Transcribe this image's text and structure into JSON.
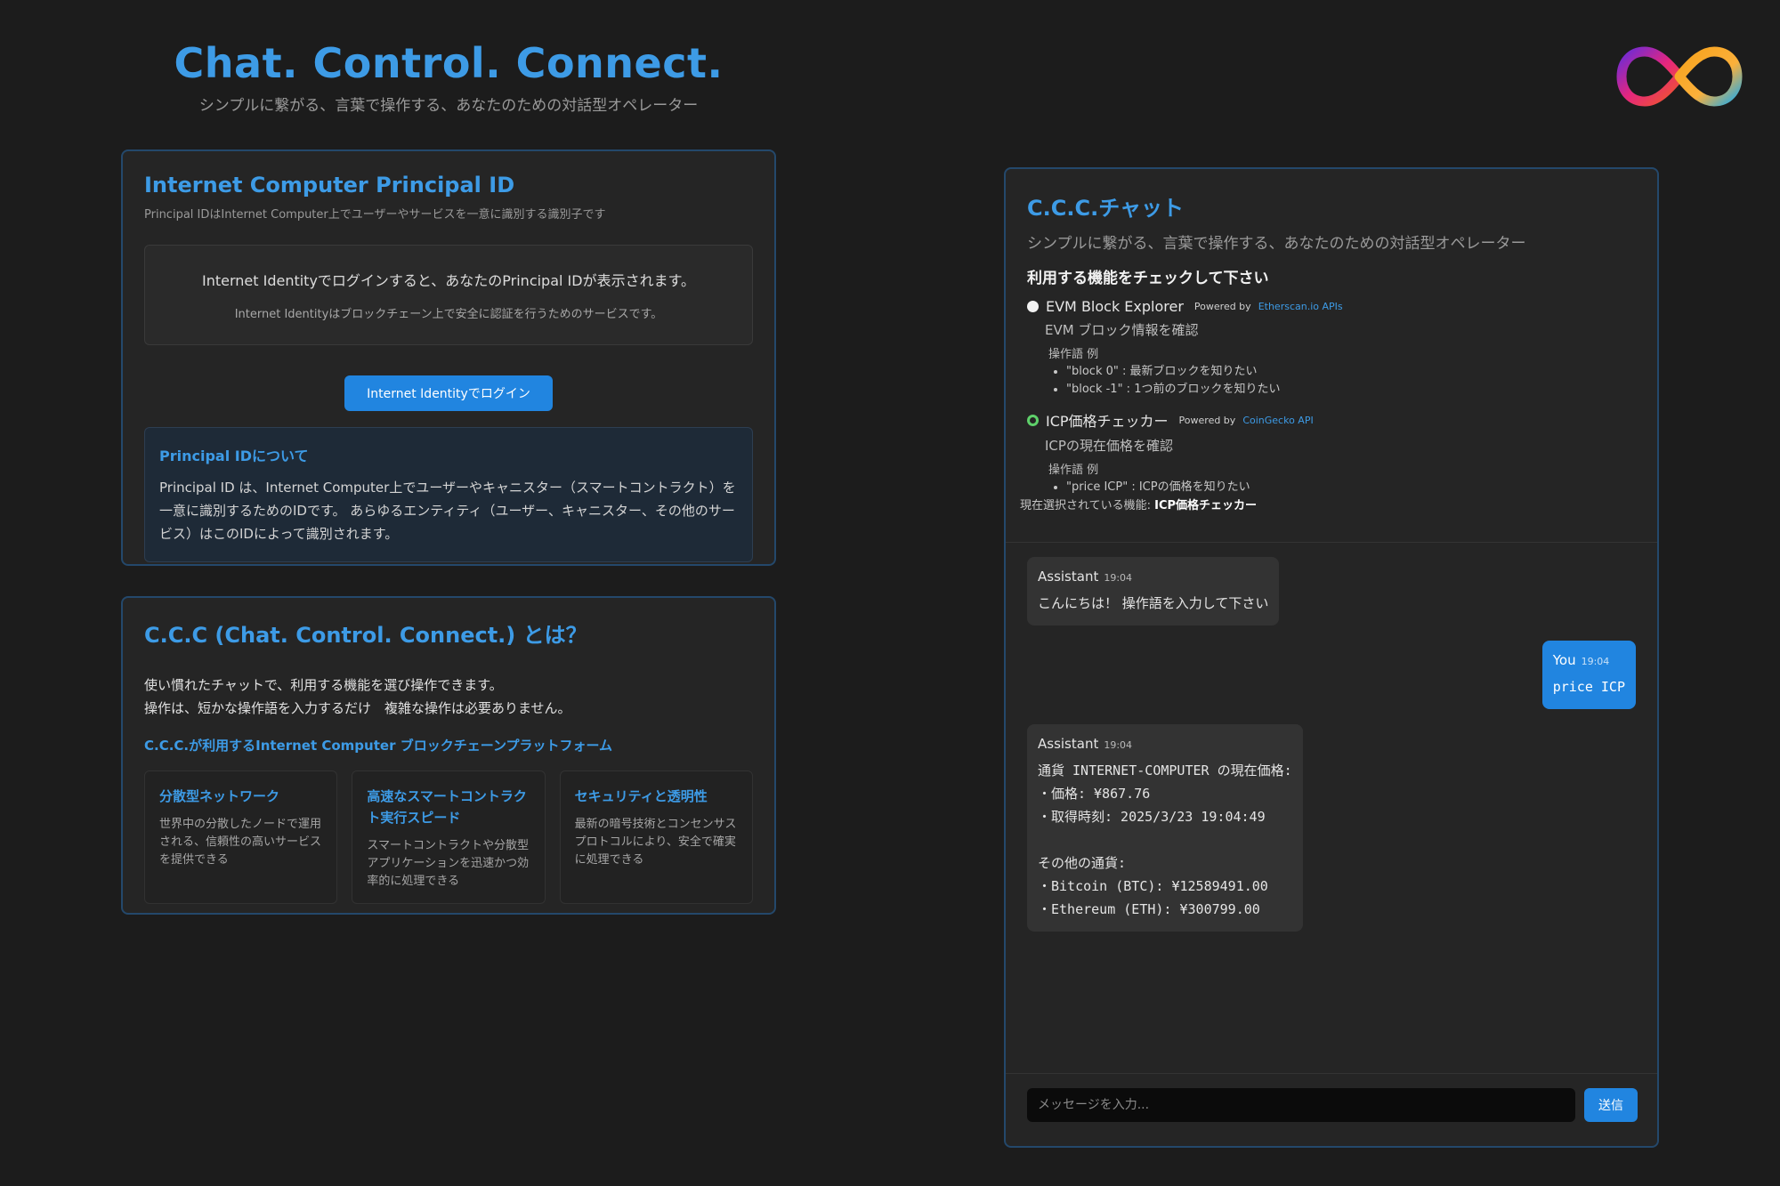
{
  "hero": {
    "title": "Chat. Control. Connect.",
    "subtitle": "シンプルに繋がる、言葉で操作する、あなたのための対話型オペレーター"
  },
  "logo": {
    "icon": "infinity-logo-icon"
  },
  "principal": {
    "title": "Internet Computer Principal ID",
    "description": "Principal IDはInternet Computer上でユーザーやサービスを一意に識別する識別子です",
    "login_box": {
      "line1": "Internet Identityでログインすると、あなたのPrincipal IDが表示されます。",
      "line2": "Internet Identityはブロックチェーン上で安全に認証を行うためのサービスです。"
    },
    "login_button": "Internet Identityでログイン",
    "about": {
      "title": "Principal IDについて",
      "body": "Principal ID は、Internet Computer上でユーザーやキャニスター（スマートコントラクト）を一意に識別するためのIDです。 あらゆるエンティティ（ユーザー、キャニスター、その他のサービス）はこのIDによって識別されます。"
    }
  },
  "ccc": {
    "title": "C.C.C (Chat. Control. Connect.) とは？",
    "line1": "使い慣れたチャットで、利用する機能を選び操作できます。",
    "line2": "操作は、短かな操作語を入力するだけ　複雑な操作は必要ありません。",
    "platform_link": "C.C.C.が利用するInternet Computer ブロックチェーンプラットフォーム",
    "features": [
      {
        "title": "分散型ネットワーク",
        "body": "世界中の分散したノードで運用される、信頼性の高いサービスを提供できる"
      },
      {
        "title": "高速なスマートコントラクト実行スピード",
        "body": "スマートコントラクトや分散型アプリケーションを迅速かつ効率的に処理できる"
      },
      {
        "title": "セキュリティと透明性",
        "body": "最新の暗号技術とコンセンサスプロトコルにより、安全で確実に処理できる"
      }
    ]
  },
  "chat": {
    "title": "C.C.C.チャット",
    "subtitle": "シンプルに繋がる、言葉で操作する、あなたのための対話型オペレーター",
    "check_label": "利用する機能をチェックして下さい",
    "options": [
      {
        "name": "EVM Block Explorer",
        "powered_by": "Powered by",
        "api": "Etherscan.io APIs",
        "desc": "EVM ブロック情報を確認",
        "examples_label": "操作語 例",
        "examples": [
          "\"block 0\" : 最新ブロックを知りたい",
          "\"block -1\" : 1つ前のブロックを知りたい"
        ],
        "selected": false
      },
      {
        "name": "ICP価格チェッカー",
        "powered_by": "Powered by",
        "api": "CoinGecko API",
        "desc": "ICPの現在価格を確認",
        "examples_label": "操作語 例",
        "examples": [
          "\"price ICP\" : ICPの価格を知りたい"
        ],
        "selected": true
      }
    ],
    "current_label": "現在選択されている機能:",
    "current_value": "ICP価格チェッカー",
    "messages": [
      {
        "sender": "Assistant",
        "time": "19:04",
        "text": "こんにちは！ 操作語を入力して下さい"
      },
      {
        "sender": "You",
        "time": "19:04",
        "text": "price ICP"
      },
      {
        "sender": "Assistant",
        "time": "19:04",
        "text": "通貨 INTERNET-COMPUTER の現在価格:\n・価格: ¥867.76\n・取得時刻: 2025/3/23 19:04:49\n\nその他の通貨:\n・Bitcoin (BTC): ¥12589491.00\n・Ethereum (ETH): ¥300799.00"
      }
    ],
    "input_placeholder": "メッセージを入力...",
    "send_label": "送信"
  },
  "colors": {
    "accent": "#3d9be6",
    "button": "#2185e0",
    "card_border": "#24486b",
    "background": "#1c1c1c",
    "selected_radio": "#5ed06a"
  }
}
